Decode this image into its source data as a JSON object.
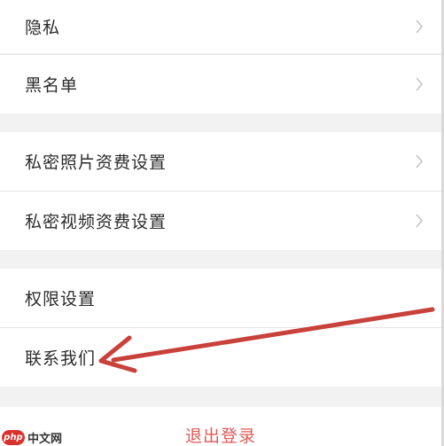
{
  "settings": {
    "items": [
      {
        "label": "隐私"
      },
      {
        "label": "黑名单"
      },
      {
        "label": "私密照片资费设置"
      },
      {
        "label": "私密视频资费设置"
      },
      {
        "label": "权限设置"
      },
      {
        "label": "联系我们"
      }
    ],
    "logout_label": "退出登录"
  },
  "watermark": {
    "badge": "php",
    "text": "中文网"
  },
  "colors": {
    "logout_text": "#e05a57",
    "annotation_arrow": "#c8413b"
  },
  "icons": {
    "row_chevron": "chevron-right-icon",
    "annotation": "red-arrow-annotation"
  }
}
